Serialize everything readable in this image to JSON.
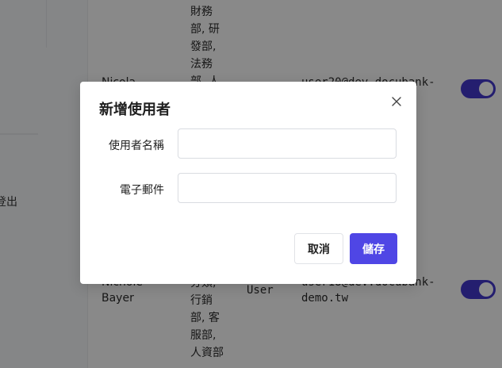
{
  "sidebar": {
    "logout_label": "登出"
  },
  "table": {
    "rows": [
      {
        "name_line1": "Nicola",
        "name_line2": "",
        "depts_text": "財務部, 研發部, 法務部, 人",
        "role": "",
        "email_line1": "user20@dev.docubank-",
        "email_line2": "",
        "toggle_on": true
      },
      {
        "name_line1": "Nichole",
        "name_line2": "Bayer",
        "depts_text": "分類, 行銷部, 客服部, 人資部",
        "role": "User",
        "email_line1": "user18@dev.docubank-",
        "email_line2": "demo.tw",
        "toggle_on": true
      }
    ]
  },
  "modal": {
    "title": "新增使用者",
    "close_icon": "close-icon",
    "fields": {
      "username": {
        "label": "使用者名稱",
        "value": "",
        "placeholder": ""
      },
      "email": {
        "label": "電子郵件",
        "value": "",
        "placeholder": ""
      }
    },
    "buttons": {
      "cancel": "取消",
      "save": "儲存"
    }
  },
  "colors": {
    "primary": "#4f46e5",
    "toggle": "#4338ca",
    "overlay": "rgba(0,0,0,0.45)"
  }
}
